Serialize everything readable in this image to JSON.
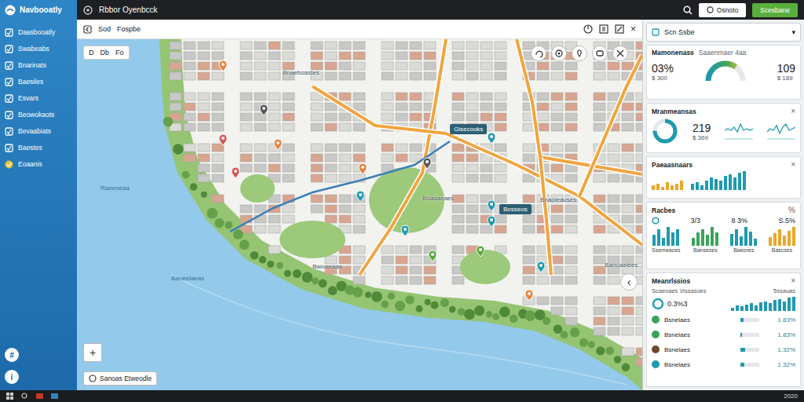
{
  "sidebar": {
    "logo": "Navbooatly",
    "items": [
      {
        "label": "Daasbooatly",
        "selected": false
      },
      {
        "label": "Swabeabs",
        "selected": false
      },
      {
        "label": "Bnarinats",
        "selected": false
      },
      {
        "label": "Baesiles",
        "selected": false
      },
      {
        "label": "Esvars",
        "selected": false
      },
      {
        "label": "Beowokaots",
        "selected": false
      },
      {
        "label": "Bevaabiats",
        "selected": false
      },
      {
        "label": "Baestes",
        "selected": false
      },
      {
        "label": "Eoaanis",
        "selected": false
      }
    ],
    "footer_icons": [
      "#",
      "i"
    ]
  },
  "topbar": {
    "title": "Rbbor Oyenbcck",
    "buttons": [
      {
        "label": "Osnoto",
        "primary": false
      },
      {
        "label": "Scesbane",
        "primary": true
      }
    ]
  },
  "map_toolbar": {
    "breadcrumb": [
      "Sod",
      "Fospbe"
    ],
    "close": "×"
  },
  "map": {
    "tools": [
      "D",
      "Db",
      "Fo"
    ],
    "zoom": [
      "+"
    ],
    "legend": "Sanoas Etweodle",
    "collapse": "‹",
    "labels": [
      {
        "text": "Raeeoeaa",
        "kind": "water"
      },
      {
        "text": "Baoeelaeas",
        "kind": "water"
      },
      {
        "text": "Bnaeboastes",
        "kind": "plain"
      },
      {
        "text": "Gisecooks",
        "kind": "tag"
      },
      {
        "text": "Bwoaeaaa",
        "kind": "plain"
      },
      {
        "text": "Bosseos",
        "kind": "tag"
      },
      {
        "text": "Bnaoleauses",
        "kind": "plain"
      },
      {
        "text": "Boasaeaes",
        "kind": "plain"
      },
      {
        "text": "Banoaelees",
        "kind": "plain"
      }
    ],
    "pins": [
      {
        "color": "#e8833a"
      },
      {
        "color": "#e8833a"
      },
      {
        "color": "#d9534f"
      },
      {
        "color": "#555555"
      },
      {
        "color": "#1e9ab0"
      },
      {
        "color": "#1e9ab0"
      },
      {
        "color": "#555555"
      },
      {
        "color": "#1e9ab0"
      },
      {
        "color": "#1e9ab0"
      },
      {
        "color": "#1e9ab0"
      },
      {
        "color": "#e8833a"
      },
      {
        "color": "#1e9ab0"
      },
      {
        "color": "#5aa83c"
      },
      {
        "color": "#e8833a"
      },
      {
        "color": "#5aa83c"
      },
      {
        "color": "#d9534f"
      }
    ]
  },
  "panel": {
    "dropdown": {
      "value": "Scn Ssbe",
      "arrow": "▾"
    },
    "cards": [
      {
        "kind": "stats",
        "title": "Mamonenass",
        "subtitle": "Saaenmaer 4aa",
        "left": {
          "value": "03%",
          "caption": "$ 300"
        },
        "gauge": {
          "level": 0.7
        },
        "right": {
          "value": "109",
          "caption": "$ 189"
        }
      },
      {
        "kind": "donut",
        "title": "Mranmeansas",
        "close": "×",
        "donut": {
          "level": 0.75
        },
        "value": "219",
        "caption": "$ 369",
        "sparklines": [
          {
            "color": "#1e9ab0",
            "values": [
              5,
              6,
              5,
              7,
              4,
              9,
              5,
              6,
              5,
              6
            ]
          },
          {
            "color": "#1e9ab0",
            "values": [
              4,
              6,
              5,
              8,
              3,
              7,
              9,
              5,
              6,
              7
            ]
          }
        ]
      },
      {
        "kind": "bars",
        "title": "Paeaasnaars",
        "close": "×",
        "series": [
          {
            "color": "#e8a72a",
            "values": [
              3,
              4,
              2,
              5,
              3,
              4,
              6
            ]
          },
          {
            "color": "#1e9ab0",
            "values": [
              4,
              5,
              3,
              6,
              8,
              7,
              6,
              9,
              10,
              8,
              11,
              12
            ]
          }
        ]
      },
      {
        "kind": "multi",
        "title": "Racbes",
        "close": "%",
        "stats": [
          "3/3",
          "8 3%",
          "S.5%"
        ],
        "charts": [
          {
            "label": "Ssemeaces",
            "color": "#1e9ab0",
            "values": [
              4,
              6,
              3,
              7,
              5,
              6
            ]
          },
          {
            "label": "Banseses",
            "color": "#3aa35a",
            "values": [
              3,
              5,
              6,
              4,
              7,
              5
            ]
          },
          {
            "label": "Baeores",
            "color": "#1e9ab0",
            "values": [
              5,
              7,
              4,
              8,
              6,
              3
            ]
          },
          {
            "label": "Bascses",
            "color": "#e8a72a",
            "values": [
              4,
              6,
              8,
              5,
              7,
              9
            ]
          }
        ]
      },
      {
        "kind": "list",
        "title": "Meanrlssios",
        "close": "×",
        "subtitle": "Scaeoaes Vissasoes",
        "subvalue": "5ssauas",
        "value": "0.3%3",
        "bars": {
          "color": "#1e9ab0",
          "values": [
            3,
            5,
            4,
            6,
            7,
            5,
            8,
            9,
            7,
            10,
            11,
            9,
            12,
            13
          ]
        },
        "rows": [
          {
            "label": "Bsnelaes",
            "value": "1.83%",
            "level": 0.15,
            "color": "#3aa35a"
          },
          {
            "label": "Bsnelaes",
            "value": "1.83%",
            "level": 0.1,
            "color": "#3aa35a"
          },
          {
            "label": "Bsnelaes",
            "value": "1.32%",
            "level": 0.25,
            "color": "#6b4a2b"
          },
          {
            "label": "Bsnelaes",
            "value": "1.32%",
            "level": 0.2,
            "color": "#1e9ab0"
          }
        ]
      }
    ]
  },
  "taskbar": {
    "clock": "2020"
  }
}
